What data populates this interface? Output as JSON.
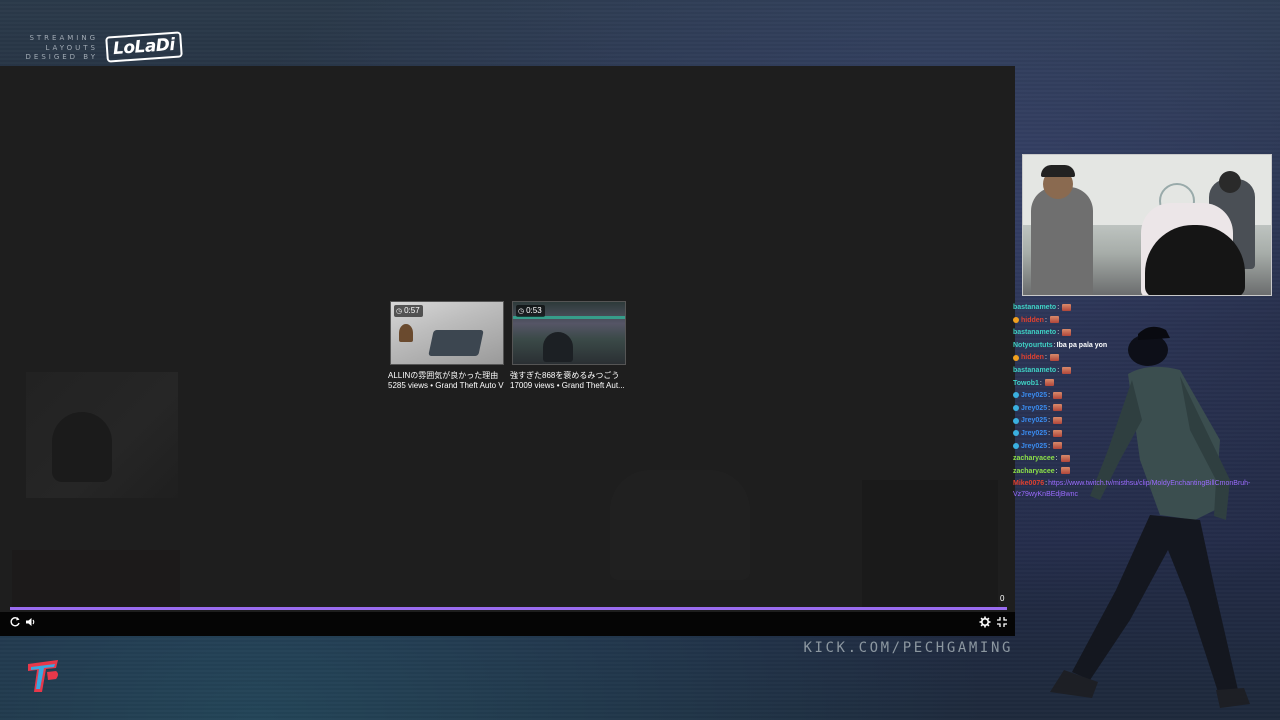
{
  "branding": {
    "tagline": "STREAMING LAYOUTS DESIGED BY",
    "logo_text": "LoLaDi"
  },
  "player": {
    "end_time": "0",
    "recommendations": [
      {
        "duration": "0:57",
        "title": "ALLINの雰囲気が良かった理由",
        "meta": "5285 views • Grand Theft Auto V"
      },
      {
        "duration": "0:53",
        "title": "強すぎた868を褒めるみつごう",
        "meta": "17009 views • Grand Theft Aut..."
      }
    ],
    "progress_percent": 100,
    "controls": {
      "replay_icon": "replay-icon",
      "volume_icon": "volume-icon",
      "settings_icon": "gear-icon",
      "fullscreen_icon": "exit-fullscreen-icon"
    }
  },
  "chat": {
    "messages": [
      {
        "user": "bastanameto",
        "color": "#3fd1c4",
        "sep": ":",
        "msg": "",
        "emote": true,
        "badge": null
      },
      {
        "user": "hidden",
        "color": "#e0402f",
        "sep": ":",
        "msg": "",
        "emote": true,
        "badge": "#f0a020"
      },
      {
        "user": "bastanameto",
        "color": "#3fd1c4",
        "sep": ":",
        "msg": "",
        "emote": true,
        "badge": null
      },
      {
        "user": "Notyourtuts",
        "color": "#3fd1c4",
        "sep": ":",
        "msg": "Iba pa pala yon",
        "emote": false,
        "badge": null
      },
      {
        "user": "hidden",
        "color": "#e0402f",
        "sep": ":",
        "msg": "",
        "emote": true,
        "badge": "#f0a020"
      },
      {
        "user": "bastanameto",
        "color": "#3fd1c4",
        "sep": ":",
        "msg": "",
        "emote": true,
        "badge": null
      },
      {
        "user": "Towob1",
        "color": "#3fd1c4",
        "sep": ":",
        "msg": "",
        "emote": true,
        "badge": null
      },
      {
        "user": "Jrey025",
        "color": "#3a8cf0",
        "sep": ":",
        "msg": "",
        "emote": true,
        "badge": "#3ab0e0"
      },
      {
        "user": "Jrey025",
        "color": "#3a8cf0",
        "sep": ":",
        "msg": "",
        "emote": true,
        "badge": "#3ab0e0"
      },
      {
        "user": "Jrey025",
        "color": "#3a8cf0",
        "sep": ":",
        "msg": "",
        "emote": true,
        "badge": "#3ab0e0"
      },
      {
        "user": "Jrey025",
        "color": "#3a8cf0",
        "sep": ":",
        "msg": "",
        "emote": true,
        "badge": "#3ab0e0"
      },
      {
        "user": "Jrey025",
        "color": "#3a8cf0",
        "sep": ":",
        "msg": "",
        "emote": true,
        "badge": "#3ab0e0"
      },
      {
        "user": "zacharyacee",
        "color": "#8ce048",
        "sep": ":",
        "msg": "",
        "emote": true,
        "badge": null
      },
      {
        "user": "zacharyacee",
        "color": "#8ce048",
        "sep": ":",
        "msg": "",
        "emote": true,
        "badge": null
      }
    ],
    "link_message": {
      "user": "Mike0076",
      "color": "#e0402f",
      "sep": ":",
      "link": "https://www.twitch.tv/misthsu/clip/MoldyEnchantingBillCmonBruh-Vz79wyKnBEdjBwnc"
    }
  },
  "overlay": {
    "url_text": "KICK.COM/PECHGAMING"
  },
  "colors": {
    "progress_accent": "#9a6cf0",
    "link_color": "#9b6bff"
  }
}
